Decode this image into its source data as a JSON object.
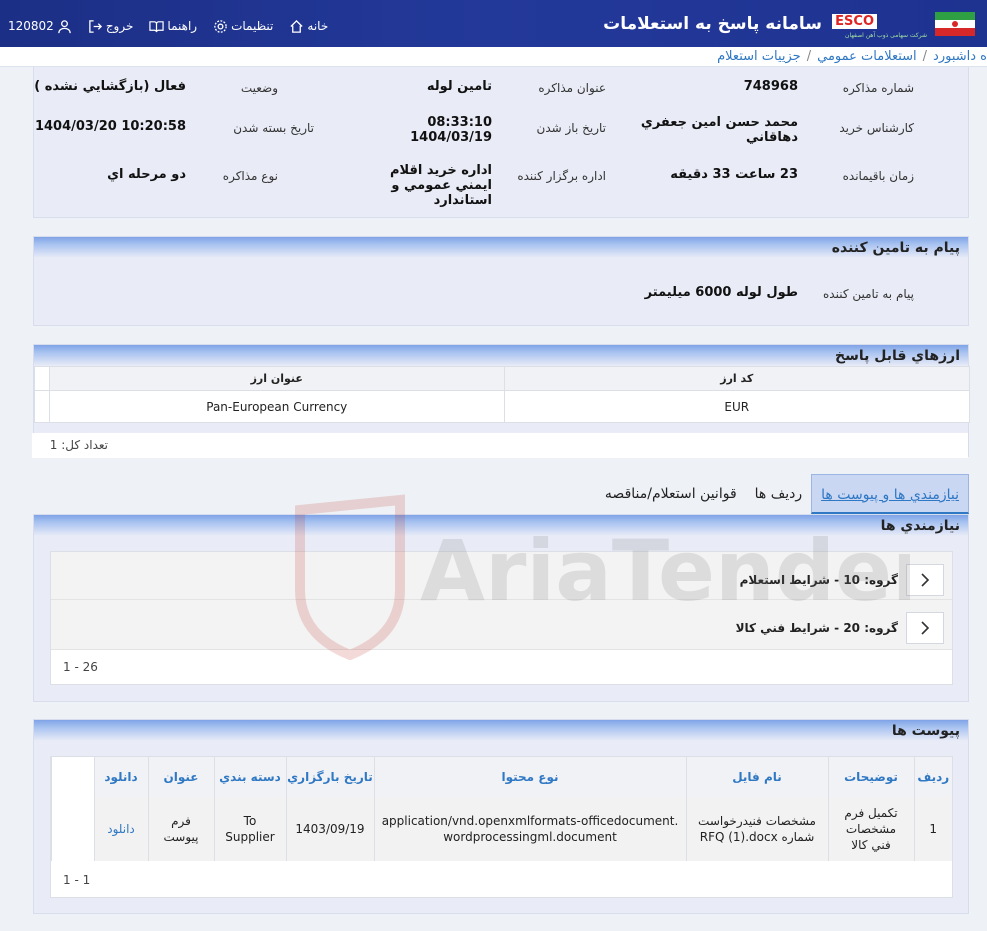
{
  "header": {
    "app_title": "سامانه پاسخ به استعلامات",
    "brand": "ESCO",
    "brand_sub": "شرکت سهامی ذوب آهن اصفهان",
    "nav": {
      "home": "خانه",
      "settings": "تنظیمات",
      "guide": "راهنما",
      "logout": "خروج",
      "user_id": "120802"
    }
  },
  "breadcrumb": {
    "items": [
      "ه داشبورد",
      "استعلامات عمومي",
      "جزييات استعلام"
    ]
  },
  "details": {
    "tender_no_label": "شماره مذاکره",
    "tender_no": "748968",
    "title_label": "عنوان مذاکره",
    "title": "تامين لوله",
    "status_label": "وضعيت",
    "status": "فعال (بازگشايي نشده )",
    "buyer_label": "کارشناس خريد",
    "buyer": "محمد حسن امين جعفري دهاقاني",
    "open_date_label": "تاريخ باز شدن",
    "open_date": "08:33:10 1404/03/19",
    "close_date_label": "تاريخ بسته شدن",
    "close_date": "1404/03/20 10:20:58",
    "remaining_label": "زمان باقيمانده",
    "remaining": "23 ساعت 33 دقيقه",
    "org_label": "اداره برگزار کننده",
    "org": "اداره خريد اقلام ايمني عمومي و استاندارد",
    "type_label": "نوع مذاکره",
    "type": "دو مرحله اي"
  },
  "message": {
    "heading": "پيام به تامين کننده",
    "label": "پيام به تامين کننده",
    "value": "طول لوله 6000 ميليمتر"
  },
  "currencies": {
    "heading": "ارزهاي قابل پاسخ",
    "columns": [
      "کد ارز",
      "عنوان ارز"
    ],
    "rows": [
      [
        "EUR",
        "Pan-European Currency"
      ]
    ],
    "total": "تعداد کل: 1"
  },
  "tabs": [
    "نيازمندي ها و پيوست ها",
    "رديف ها",
    "قوانين استعلام/مناقصه"
  ],
  "requirements": {
    "heading": "نيازمندي ها",
    "groups": [
      "گروه: 10 - شرايط استعلام",
      "گروه: 20 - شرايط فني کالا"
    ],
    "pager": "1 - 26"
  },
  "attachments": {
    "heading": "پيوست ها",
    "columns": [
      "رديف",
      "توضيحات",
      "نام فايل",
      "نوع محتوا",
      "تاريخ بارگزاري",
      "دسته بندي",
      "عنوان",
      "دانلود"
    ],
    "rows": [
      [
        "1",
        "تکميل فرم مشخصات فني کالا",
        "مشخصات فنيدرخواست شماره RFQ (1).docx",
        "application/vnd.openxmlformats-officedocument.wordprocessingml.document",
        "1403/09/19",
        "To Supplier",
        "فرم پيوست",
        "دانلود"
      ]
    ],
    "pager": "1 - 1"
  },
  "watermark": "AriaTender.neT",
  "colors": {
    "header": "#1e3290",
    "accent": "#2f78c4",
    "panel": "#e9ecf7"
  }
}
